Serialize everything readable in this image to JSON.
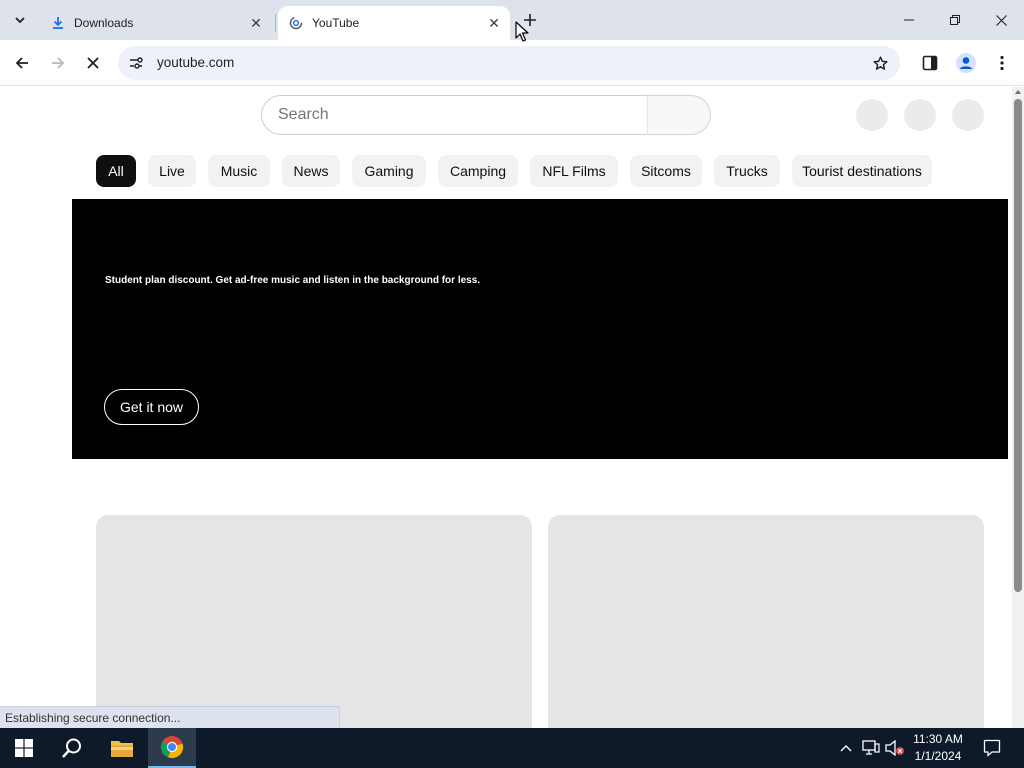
{
  "browser": {
    "tabs": [
      {
        "title": "Downloads",
        "active": false
      },
      {
        "title": "YouTube",
        "active": true
      }
    ],
    "address": "youtube.com",
    "status_text": "Establishing secure connection..."
  },
  "youtube": {
    "search_placeholder": "Search",
    "chips": [
      "All",
      "Live",
      "Music",
      "News",
      "Gaming",
      "Camping",
      "NFL Films",
      "Sitcoms",
      "Trucks",
      "Tourist destinations"
    ],
    "selected_chip": "All",
    "banner": {
      "message": "Student plan discount. Get ad-free music and listen in the background for less.",
      "cta": "Get it now"
    }
  },
  "taskbar": {
    "time": "11:30 AM",
    "date": "1/1/2024"
  },
  "colors": {
    "tabstrip": "#dee3eb",
    "omnibox": "#eef1f7",
    "banner_bg": "#000000",
    "chip_selected": "#0f0f0f",
    "skeleton": "#e5e5e5",
    "taskbar": "#0e1a2a"
  }
}
